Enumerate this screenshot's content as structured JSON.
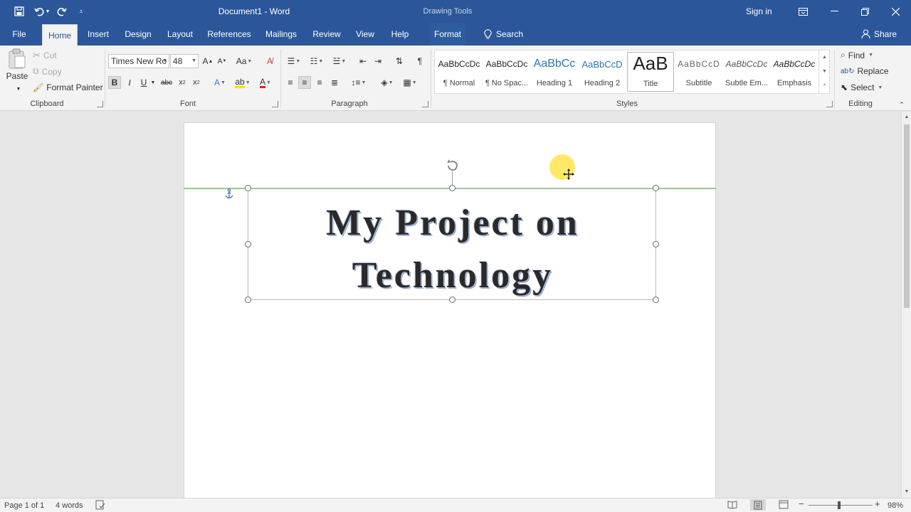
{
  "window": {
    "doc_title": "Document1  -  Word",
    "context_tab_group": "Drawing Tools",
    "sign_in": "Sign in"
  },
  "tabs": [
    "File",
    "Home",
    "Insert",
    "Design",
    "Layout",
    "References",
    "Mailings",
    "Review",
    "View",
    "Help",
    "Format"
  ],
  "active_tab": "Home",
  "search": {
    "label": "Search"
  },
  "share": {
    "label": "Share"
  },
  "clipboard": {
    "paste": "Paste",
    "cut": "Cut",
    "copy": "Copy",
    "format_painter": "Format Painter",
    "group_label": "Clipboard"
  },
  "font": {
    "family": "Times New Ro",
    "size": "48",
    "group_label": "Font"
  },
  "paragraph": {
    "group_label": "Paragraph"
  },
  "styles": {
    "group_label": "Styles",
    "items": [
      {
        "preview": "AaBbCcDc",
        "name": "¶ Normal"
      },
      {
        "preview": "AaBbCcDc",
        "name": "¶ No Spac..."
      },
      {
        "preview": "AaBbCc",
        "name": "Heading 1"
      },
      {
        "preview": "AaBbCcD",
        "name": "Heading 2"
      },
      {
        "preview": "AaB",
        "name": "Title"
      },
      {
        "preview": "AaBbCcD",
        "name": "Subtitle"
      },
      {
        "preview": "AaBbCcDc",
        "name": "Subtle Em..."
      },
      {
        "preview": "AaBbCcDc",
        "name": "Emphasis"
      }
    ],
    "selected": "Title"
  },
  "editing": {
    "find": "Find",
    "replace": "Replace",
    "select": "Select",
    "group_label": "Editing"
  },
  "document": {
    "title_line1": "My Project on",
    "title_line2": "Technology"
  },
  "status": {
    "page": "Page 1 of 1",
    "words": "4 words",
    "zoom": "98%"
  },
  "colors": {
    "accent": "#2b579a",
    "guide": "#7cc47c",
    "cursor_highlight": "#ffe132"
  }
}
